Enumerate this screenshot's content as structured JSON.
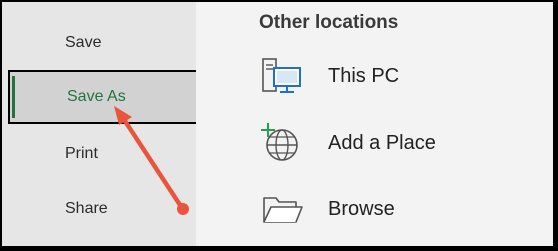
{
  "sidebar": {
    "items": [
      {
        "label": "Save"
      },
      {
        "label": "Save As"
      },
      {
        "label": "Print"
      },
      {
        "label": "Share"
      }
    ]
  },
  "main": {
    "section_title": "Other locations",
    "locations": [
      {
        "label": "This PC",
        "icon": "this-pc-icon"
      },
      {
        "label": "Add a Place",
        "icon": "add-place-icon"
      },
      {
        "label": "Browse",
        "icon": "folder-icon"
      }
    ]
  },
  "colors": {
    "accent_green": "#21743f",
    "annotation_arrow": "#e8553c",
    "computer_blue": "#1e6fd0"
  }
}
